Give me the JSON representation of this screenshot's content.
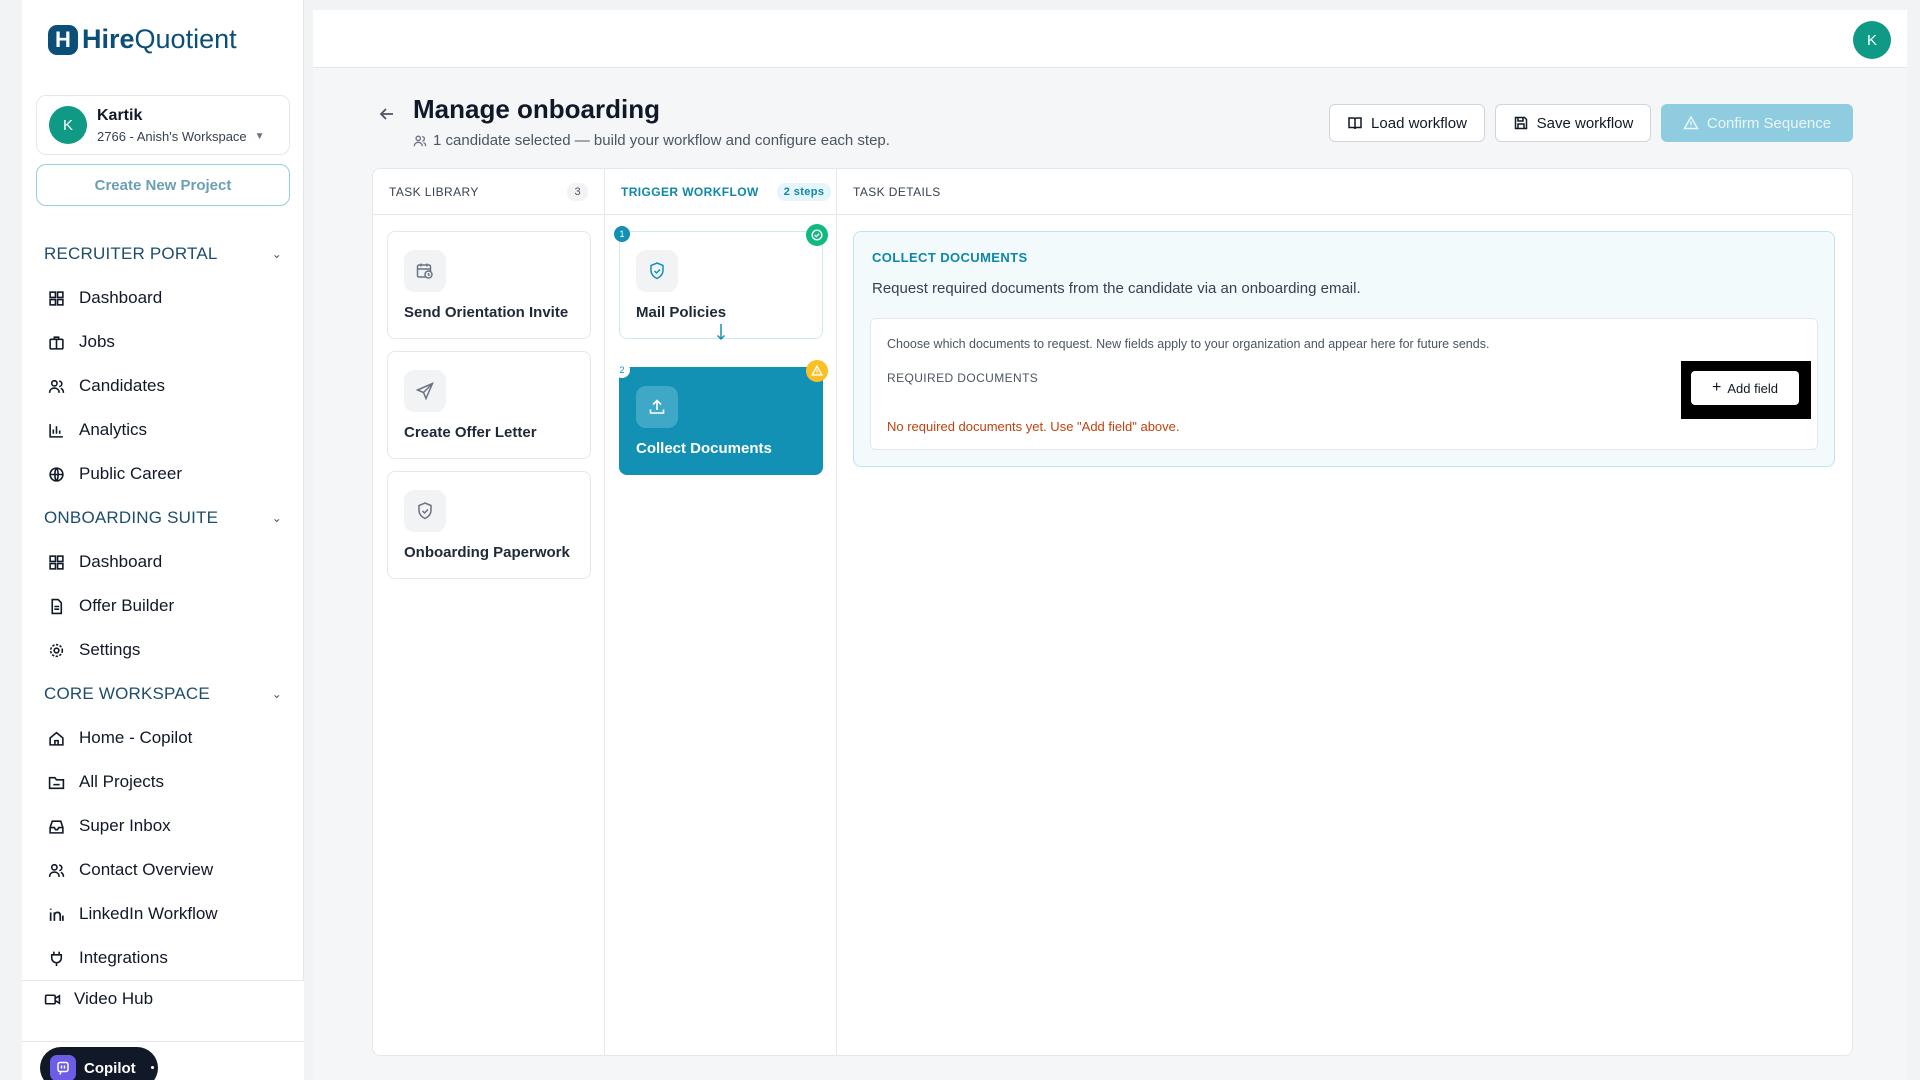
{
  "brand": {
    "mark": "H",
    "name_bold": "Hire",
    "name_rest": "Quotient",
    "color": "#0b4f79"
  },
  "workspace": {
    "initial": "K",
    "user": "Kartik",
    "name": "2766 - Anish's Workspace"
  },
  "sidebar": {
    "create_project": "Create New Project",
    "sections": [
      {
        "title": "RECRUITER PORTAL",
        "items": [
          "Dashboard",
          "Jobs",
          "Candidates",
          "Analytics",
          "Public Career"
        ]
      },
      {
        "title": "ONBOARDING SUITE",
        "items": [
          "Dashboard",
          "Offer Builder",
          "Settings"
        ]
      },
      {
        "title": "CORE WORKSPACE",
        "items": [
          "Home - Copilot",
          "All Projects",
          "Super Inbox",
          "Contact Overview",
          "LinkedIn Workflow",
          "Integrations"
        ]
      }
    ],
    "video_hub": "Video Hub",
    "copilot": "Copilot"
  },
  "topbar": {
    "avatar_initial": "K"
  },
  "header": {
    "title": "Manage onboarding",
    "subtitle": "1 candidate selected — build your workflow and configure each step.",
    "load_workflow": "Load workflow",
    "save_workflow": "Save workflow",
    "confirm_sequence": "Confirm Sequence"
  },
  "library": {
    "heading": "TASK LIBRARY",
    "count": "3",
    "tasks": [
      {
        "label": "Send Orientation Invite",
        "icon": "calendar-clock-icon"
      },
      {
        "label": "Create Offer Letter",
        "icon": "send-icon"
      },
      {
        "label": "Onboarding Paperwork",
        "icon": "shield-check-icon"
      }
    ]
  },
  "workflow": {
    "heading": "TRIGGER WORKFLOW",
    "steps_count": "2 steps",
    "steps": [
      {
        "number": "1",
        "label": "Mail Policies",
        "icon": "shield-check-icon",
        "status": "complete"
      },
      {
        "number": "2",
        "label": "Collect Documents",
        "icon": "upload-icon",
        "status": "warning",
        "active": true
      }
    ]
  },
  "details": {
    "heading": "TASK DETAILS",
    "task_title": "COLLECT DOCUMENTS",
    "task_description": "Request required documents from the candidate via an onboarding email.",
    "hint": "Choose which documents to request. New fields apply to your organization and appear here for future sends.",
    "required_label": "REQUIRED DOCUMENTS",
    "add_field": "Add field",
    "empty_message": "No required documents yet. Use \"Add field\" above."
  },
  "colors": {
    "accent": "#1391b5",
    "success": "#10b981",
    "warning": "#fbbf24",
    "error_text": "#c2410c"
  }
}
